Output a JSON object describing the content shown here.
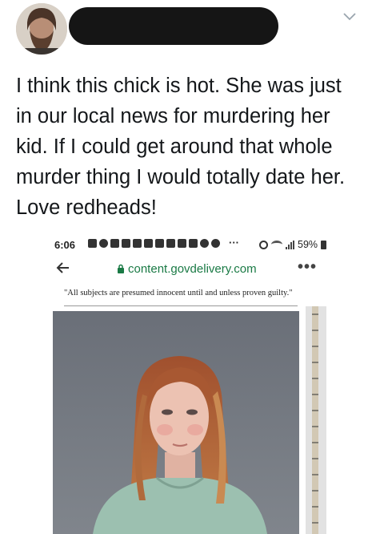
{
  "header": {
    "avatar": "user-avatar",
    "name_redacted": true,
    "menu_icon": "chevron-down-icon"
  },
  "tweet": {
    "text": "I think this chick is hot. She was just\nin our local news for murdering her\nkid. If I could get around that whole\nmurder thing I would totally date her.\nLove redheads!"
  },
  "embedded_screenshot": {
    "status_bar": {
      "time": "6:06",
      "more": "···",
      "battery": "59%"
    },
    "browser": {
      "back_icon": "arrow-left-icon",
      "url": "content.govdelivery.com",
      "menu": "•••"
    },
    "disclaimer": "\"All subjects are presumed innocent until and unless proven guilty.\"",
    "image": "booking-photo"
  },
  "colors": {
    "text": "#14171a",
    "redaction": "#151515",
    "url_green": "#1a7a45"
  }
}
